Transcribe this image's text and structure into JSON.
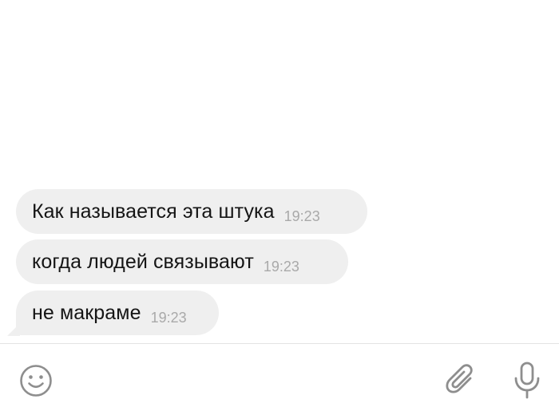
{
  "messages": [
    {
      "text": "Как называется эта штука",
      "time": "19:23"
    },
    {
      "text": "когда людей связывают",
      "time": "19:23"
    },
    {
      "text": "не макраме",
      "time": "19:23"
    }
  ],
  "composer": {
    "icons": [
      "smiley-icon",
      "paperclip-icon",
      "microphone-icon"
    ]
  },
  "colors": {
    "bubble": "#efefef",
    "text": "#151515",
    "time": "#a9a9a9",
    "icon": "#8e8e8e"
  }
}
